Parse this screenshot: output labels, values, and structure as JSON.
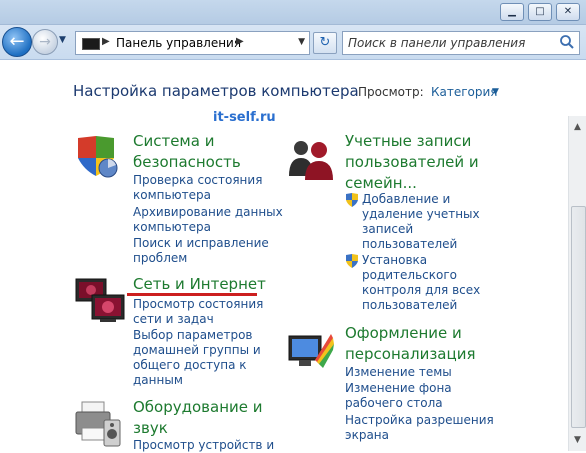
{
  "window": {
    "minimize": "▁",
    "maximize": "□",
    "close": "✕"
  },
  "nav": {
    "address_crumb": "Панель управления",
    "search_placeholder": "Поиск в панели управления"
  },
  "header": {
    "title": "Настройка параметров компьютера",
    "view_label": "Просмотр:",
    "view_value": "Категория"
  },
  "watermark": "it-self.ru",
  "categories_left": [
    {
      "title_lines": [
        "Система и",
        "безопасность"
      ],
      "links": [
        [
          "Проверка состояния",
          "компьютера"
        ],
        [
          "Архивирование данных",
          "компьютера"
        ],
        [
          "Поиск и исправление",
          "проблем"
        ]
      ]
    },
    {
      "title_lines": [
        "Сеть и Интернет"
      ],
      "links": [
        [
          "Просмотр состояния",
          "сети и задач"
        ],
        [
          "Выбор параметров",
          "домашней группы и",
          "общего доступа к",
          "данным"
        ]
      ]
    },
    {
      "title_lines": [
        "Оборудование и",
        "звук"
      ],
      "links": [
        [
          "Просмотр устройств и"
        ]
      ]
    }
  ],
  "categories_right": [
    {
      "title_lines": [
        "Учетные записи",
        "пользователей и",
        "семейн..."
      ],
      "links": [
        [
          "Добавление и",
          "удаление учетных",
          "записей",
          "пользователей"
        ],
        [
          "Установка",
          "родительского",
          "контроля для всех",
          "пользователей"
        ]
      ]
    },
    {
      "title_lines": [
        "Оформление и",
        "персонализация"
      ],
      "links": [
        [
          "Изменение темы"
        ],
        [
          "Изменение фона",
          "рабочего стола"
        ],
        [
          "Настройка разрешения",
          "экрана"
        ]
      ]
    }
  ],
  "colors": {
    "category_green": "#1d7a2f",
    "link_blue": "#1f4e8c",
    "underline_red": "#cc1f1f"
  }
}
